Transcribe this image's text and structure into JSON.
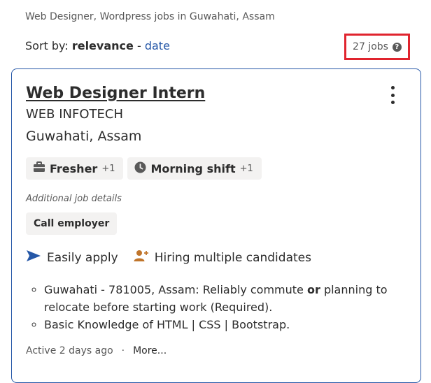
{
  "header": {
    "breadcrumb": "Web Designer, Wordpress jobs in Guwahati, Assam",
    "sort_prefix": "Sort by:",
    "sort_active": "relevance",
    "sort_sep": "-",
    "sort_alt": "date",
    "job_count": "27 jobs",
    "help_glyph": "?"
  },
  "job": {
    "title": "Web Designer Intern",
    "company": "WEB INFOTECH",
    "location": "Guwahati, Assam",
    "pills": [
      {
        "label": "Fresher",
        "extra": "+1",
        "icon": "briefcase-icon"
      },
      {
        "label": "Morning shift",
        "extra": "+1",
        "icon": "clock-icon"
      }
    ],
    "additional_details": "Additional job details",
    "call_button": "Call employer",
    "features": [
      {
        "label": "Easily apply",
        "icon": "send-arrow-icon",
        "color": "#2557a7"
      },
      {
        "label": "Hiring multiple candidates",
        "icon": "person-add-icon",
        "color": "#c0752b"
      }
    ],
    "bullets": [
      {
        "pre": "Guwahati - 781005, Assam: Reliably commute ",
        "bold": "or",
        "post": " planning to relocate before starting work (Required)."
      },
      {
        "pre": "Basic Knowledge of HTML | CSS | Bootstrap.",
        "bold": "",
        "post": ""
      }
    ],
    "active": "Active 2 days ago",
    "dot": "·",
    "more": "More..."
  },
  "colors": {
    "accent": "#2557a7",
    "highlight": "#e0242e"
  }
}
